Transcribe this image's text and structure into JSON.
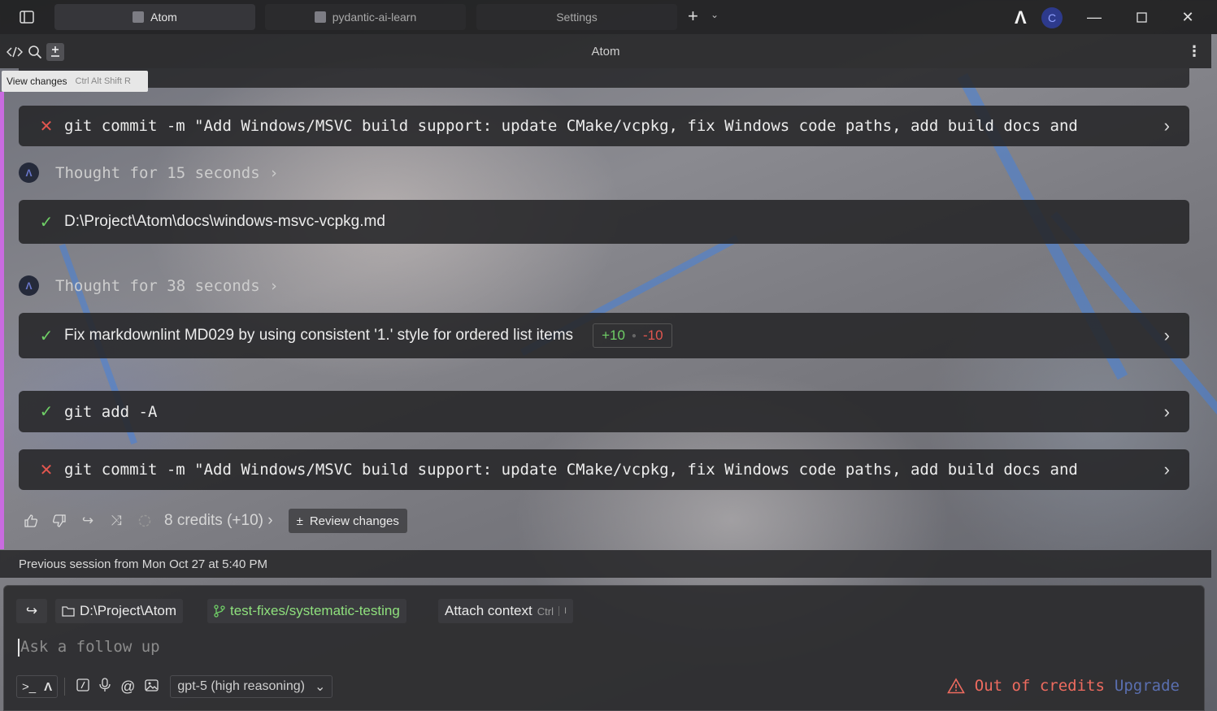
{
  "window": {
    "tabs": [
      {
        "label": "Atom",
        "active": true
      },
      {
        "label": "pydantic-ai-learn",
        "active": false
      },
      {
        "label": "Settings",
        "active": false
      }
    ],
    "avatar_letter": "C",
    "logo_glyph": "Λ"
  },
  "toolbar": {
    "title": "Atom",
    "tooltip_label": "View changes",
    "tooltip_shortcut": "Ctrl Alt Shift R"
  },
  "conversation": {
    "items": [
      {
        "kind": "command",
        "status": "fail",
        "text": "git commit -m \"Add Windows/MSVC build support: update CMake/vcpkg, fix Windows code paths, add build docs and"
      },
      {
        "kind": "thought",
        "text": "Thought for 15 seconds"
      },
      {
        "kind": "file",
        "status": "ok",
        "text": "D:\\Project\\Atom\\docs\\windows-msvc-vcpkg.md"
      },
      {
        "kind": "thought",
        "text": "Thought for 38 seconds"
      },
      {
        "kind": "edit",
        "status": "ok",
        "text": "Fix markdownlint MD029 by using consistent '1.' style for ordered list items",
        "added": "+10",
        "removed": "-10"
      },
      {
        "kind": "command",
        "status": "ok",
        "text": "git add -A"
      },
      {
        "kind": "command",
        "status": "fail",
        "text": "git commit -m \"Add Windows/MSVC build support: update CMake/vcpkg, fix Windows code paths, add build docs and"
      }
    ],
    "credits_label": "8 credits (+10)",
    "review_label": "Review changes",
    "previous_session": "Previous session from Mon Oct 27 at 5:40 PM"
  },
  "composer": {
    "folder": "D:\\Project\\Atom",
    "branch": "test-fixes/systematic-testing",
    "attach_label": "Attach context",
    "attach_shortcut": "Ctrl",
    "attach_key": "I",
    "placeholder": "Ask a follow up",
    "model": "gpt-5 (high reasoning)",
    "warning": "Out of credits",
    "upgrade": "Upgrade"
  },
  "colors": {
    "success": "#6fcf66",
    "error": "#e2564f",
    "accent_bar": "#c96be0",
    "avatar_bg": "#2d3a8c"
  }
}
